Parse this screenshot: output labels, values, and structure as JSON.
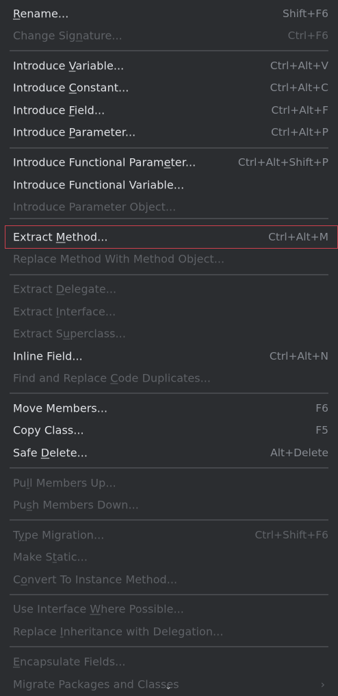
{
  "menu": {
    "items": [
      {
        "id": "rename",
        "label": "Rename...",
        "mnemonic_index": 0,
        "shortcut": "Shift+F6",
        "disabled": false,
        "selected": false
      },
      {
        "id": "change-signature",
        "label": "Change Signature...",
        "mnemonic_index": 10,
        "shortcut": "Ctrl+F6",
        "disabled": true,
        "selected": false
      },
      {
        "id": "introduce-variable",
        "label": "Introduce Variable...",
        "mnemonic_index": 10,
        "shortcut": "Ctrl+Alt+V",
        "disabled": false,
        "selected": false
      },
      {
        "id": "introduce-constant",
        "label": "Introduce Constant...",
        "mnemonic_index": 10,
        "shortcut": "Ctrl+Alt+C",
        "disabled": false,
        "selected": false
      },
      {
        "id": "introduce-field",
        "label": "Introduce Field...",
        "mnemonic_index": 10,
        "shortcut": "Ctrl+Alt+F",
        "disabled": false,
        "selected": false
      },
      {
        "id": "introduce-parameter",
        "label": "Introduce Parameter...",
        "mnemonic_index": 10,
        "shortcut": "Ctrl+Alt+P",
        "disabled": false,
        "selected": false
      },
      {
        "id": "introduce-functional-parameter",
        "label": "Introduce Functional Parameter...",
        "mnemonic_index": 26,
        "shortcut": "Ctrl+Alt+Shift+P",
        "disabled": false,
        "selected": false
      },
      {
        "id": "introduce-functional-variable",
        "label": "Introduce Functional Variable...",
        "mnemonic_index": -1,
        "shortcut": "",
        "disabled": false,
        "selected": false
      },
      {
        "id": "introduce-parameter-object",
        "label": "Introduce Parameter Object...",
        "mnemonic_index": -1,
        "shortcut": "",
        "disabled": true,
        "selected": false
      },
      {
        "id": "extract-method",
        "label": "Extract Method...",
        "mnemonic_index": 8,
        "shortcut": "Ctrl+Alt+M",
        "disabled": false,
        "selected": true
      },
      {
        "id": "replace-method-with-method-object",
        "label": "Replace Method With Method Object...",
        "mnemonic_index": -1,
        "shortcut": "",
        "disabled": true,
        "selected": false
      },
      {
        "id": "extract-delegate",
        "label": "Extract Delegate...",
        "mnemonic_index": 8,
        "shortcut": "",
        "disabled": true,
        "selected": false
      },
      {
        "id": "extract-interface",
        "label": "Extract Interface...",
        "mnemonic_index": 8,
        "shortcut": "",
        "disabled": true,
        "selected": false
      },
      {
        "id": "extract-superclass",
        "label": "Extract Superclass...",
        "mnemonic_index": 9,
        "shortcut": "",
        "disabled": true,
        "selected": false
      },
      {
        "id": "inline-field",
        "label": "Inline Field...",
        "mnemonic_index": -1,
        "shortcut": "Ctrl+Alt+N",
        "disabled": false,
        "selected": false
      },
      {
        "id": "find-and-replace-code-duplicates",
        "label": "Find and Replace Code Duplicates...",
        "mnemonic_index": 17,
        "shortcut": "",
        "disabled": true,
        "selected": false
      },
      {
        "id": "move-members",
        "label": "Move Members...",
        "mnemonic_index": -1,
        "shortcut": "F6",
        "disabled": false,
        "selected": false
      },
      {
        "id": "copy-class",
        "label": "Copy Class...",
        "mnemonic_index": -1,
        "shortcut": "F5",
        "disabled": false,
        "selected": false
      },
      {
        "id": "safe-delete",
        "label": "Safe Delete...",
        "mnemonic_index": 5,
        "shortcut": "Alt+Delete",
        "disabled": false,
        "selected": false
      },
      {
        "id": "pull-members-up",
        "label": "Pull Members Up...",
        "mnemonic_index": 2,
        "shortcut": "",
        "disabled": true,
        "selected": false
      },
      {
        "id": "push-members-down",
        "label": "Push Members Down...",
        "mnemonic_index": 2,
        "shortcut": "",
        "disabled": true,
        "selected": false
      },
      {
        "id": "type-migration",
        "label": "Type Migration...",
        "mnemonic_index": 1,
        "shortcut": "Ctrl+Shift+F6",
        "disabled": true,
        "selected": false
      },
      {
        "id": "make-static",
        "label": "Make Static...",
        "mnemonic_index": 6,
        "shortcut": "",
        "disabled": true,
        "selected": false
      },
      {
        "id": "convert-to-instance-method",
        "label": "Convert To Instance Method...",
        "mnemonic_index": 1,
        "shortcut": "",
        "disabled": true,
        "selected": false
      },
      {
        "id": "use-interface-where-possible",
        "label": "Use Interface Where Possible...",
        "mnemonic_index": 14,
        "shortcut": "",
        "disabled": true,
        "selected": false
      },
      {
        "id": "replace-inheritance-with-delegation",
        "label": "Replace Inheritance with Delegation...",
        "mnemonic_index": 8,
        "shortcut": "",
        "disabled": true,
        "selected": false
      },
      {
        "id": "encapsulate-fields",
        "label": "Encapsulate Fields...",
        "mnemonic_index": 0,
        "shortcut": "",
        "disabled": true,
        "selected": false
      },
      {
        "id": "migrate-packages-and-classes",
        "label": "Migrate Packages and Classes",
        "mnemonic_index": -1,
        "shortcut": "",
        "disabled": true,
        "selected": false,
        "submenu": true,
        "submenu_icon": "chevron-right-icon"
      }
    ],
    "scroll_indicator_icon": "chevron-down-icon"
  },
  "colors": {
    "background": "#2b2d30",
    "text": "#dfe1e5",
    "shortcut_text": "#868a91",
    "disabled_text": "#5f6267",
    "separator": "#46484c",
    "selection_outline": "#d0414e"
  }
}
